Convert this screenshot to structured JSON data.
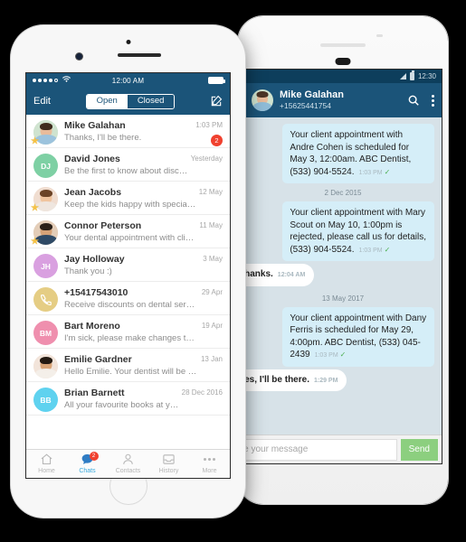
{
  "left_phone": {
    "status_bar": {
      "time": "12:00 AM",
      "carrier_dots": 5,
      "wifi_icon": "wifi-icon",
      "battery_icon": "battery-full-icon"
    },
    "nav": {
      "edit_label": "Edit",
      "segment": {
        "options": [
          "Open",
          "Closed"
        ],
        "selected": "Open"
      },
      "compose_icon": "compose-icon"
    },
    "conversations": [
      {
        "name": "Mike Galahan",
        "preview": "Thanks, I'll be there.",
        "time": "1:03 PM",
        "badge": "2",
        "starred": true,
        "avatar_type": "photo",
        "avatar_color": "#cfe3cf",
        "initials": ""
      },
      {
        "name": "David Jones",
        "preview": "Be the first to know about discounts and…",
        "time": "Yesterday",
        "badge": "",
        "starred": false,
        "avatar_type": "initials",
        "avatar_color": "#7ed0a4",
        "initials": "DJ"
      },
      {
        "name": "Jean Jacobs",
        "preview": "Keep the kids happy with special offer for…",
        "time": "12 May",
        "badge": "",
        "starred": true,
        "avatar_type": "photo",
        "avatar_color": "#f0ddd0",
        "initials": ""
      },
      {
        "name": "Connor Peterson",
        "preview": "Your dental appointment with client will b…",
        "time": "11 May",
        "badge": "",
        "starred": true,
        "avatar_type": "photo",
        "avatar_color": "#e3cdb8",
        "initials": ""
      },
      {
        "name": "Jay Holloway",
        "preview": "Thank you :)",
        "time": "3 May",
        "badge": "",
        "starred": false,
        "avatar_type": "initials",
        "avatar_color": "#d9a0e0",
        "initials": "JH"
      },
      {
        "name": "+15417543010",
        "preview": "Receive discounts on dental services on…",
        "time": "29 Apr",
        "badge": "",
        "starred": false,
        "avatar_type": "phone-icon",
        "avatar_color": "#e5cd84",
        "initials": ""
      },
      {
        "name": "Bart Moreno",
        "preview": "I'm sick, please make changes to my cale…",
        "time": "19 Apr",
        "badge": "",
        "starred": false,
        "avatar_type": "initials",
        "avatar_color": "#ef8fae",
        "initials": "BM"
      },
      {
        "name": "Emilie Gardner",
        "preview": "Hello Emilie. Your dentist will be ready to…",
        "time": "13 Jan",
        "badge": "",
        "starred": false,
        "avatar_type": "photo",
        "avatar_color": "#f2e4da",
        "initials": ""
      },
      {
        "name": "Brian Barnett",
        "preview": "All your favourite books at your reach! Got…",
        "time": "28 Dec 2016",
        "badge": "",
        "starred": false,
        "avatar_type": "initials",
        "avatar_color": "#5fd2ef",
        "initials": "BB"
      }
    ],
    "tabs": [
      {
        "label": "Home",
        "icon": "home-icon",
        "active": false,
        "badge": ""
      },
      {
        "label": "Chats",
        "icon": "chat-icon",
        "active": true,
        "badge": "2"
      },
      {
        "label": "Contacts",
        "icon": "contacts-icon",
        "active": false,
        "badge": ""
      },
      {
        "label": "History",
        "icon": "history-icon",
        "active": false,
        "badge": ""
      },
      {
        "label": "More",
        "icon": "more-dots-icon",
        "active": false,
        "badge": ""
      }
    ]
  },
  "right_phone": {
    "status_bar": {
      "time": "12:30",
      "signal_icon": "signal-icon",
      "battery_icon": "battery-icon"
    },
    "nav": {
      "contact_name": "Mike Galahan",
      "contact_number": "+15625441754",
      "search_icon": "search-icon",
      "overflow_icon": "overflow-menu-icon",
      "avatar": "contact-avatar"
    },
    "messages": [
      {
        "kind": "bubble",
        "side": "in",
        "text": "Your client appointment with Andre Cohen is scheduled for May 3, 12:00am. ABC Dentist, (533) 904-5524.",
        "time": "1:03 PM",
        "tick": "✓"
      },
      {
        "kind": "date",
        "text": "2 Dec 2015"
      },
      {
        "kind": "bubble",
        "side": "in",
        "text": "Your client appointment with Mary Scout on May 10, 1:00pm is rejected, please call us for details, (533) 904-5524.",
        "time": "1:03 PM",
        "tick": "✓"
      },
      {
        "kind": "bubble",
        "side": "out",
        "text": "Thanks.",
        "time": "12:04 AM",
        "tick": ""
      },
      {
        "kind": "date",
        "text": "13 May 2017"
      },
      {
        "kind": "bubble",
        "side": "in",
        "text": "Your client appointment with Dany Ferris is scheduled for May 29, 4:00pm. ABC Dentist, (533) 045-2439",
        "time": "1:03 PM",
        "tick": "✓"
      },
      {
        "kind": "bubble",
        "side": "out",
        "text": "Yes, I'll be there.",
        "time": "1:29 PM",
        "tick": ""
      }
    ],
    "composer": {
      "placeholder": "Type your message",
      "value": "",
      "send_label": "Send"
    }
  },
  "colors": {
    "navy": "#1b5479",
    "status_navy": "#0d3e5c",
    "chat_bg": "#d7e2e8",
    "bubble_in": "#d5eef8",
    "bubble_out": "#ffffff",
    "send_green": "#8ccf7f",
    "badge_red": "#f0412f",
    "tab_active": "#39a9dd",
    "star_yellow": "#f6c244",
    "page_bg": "#000000"
  }
}
